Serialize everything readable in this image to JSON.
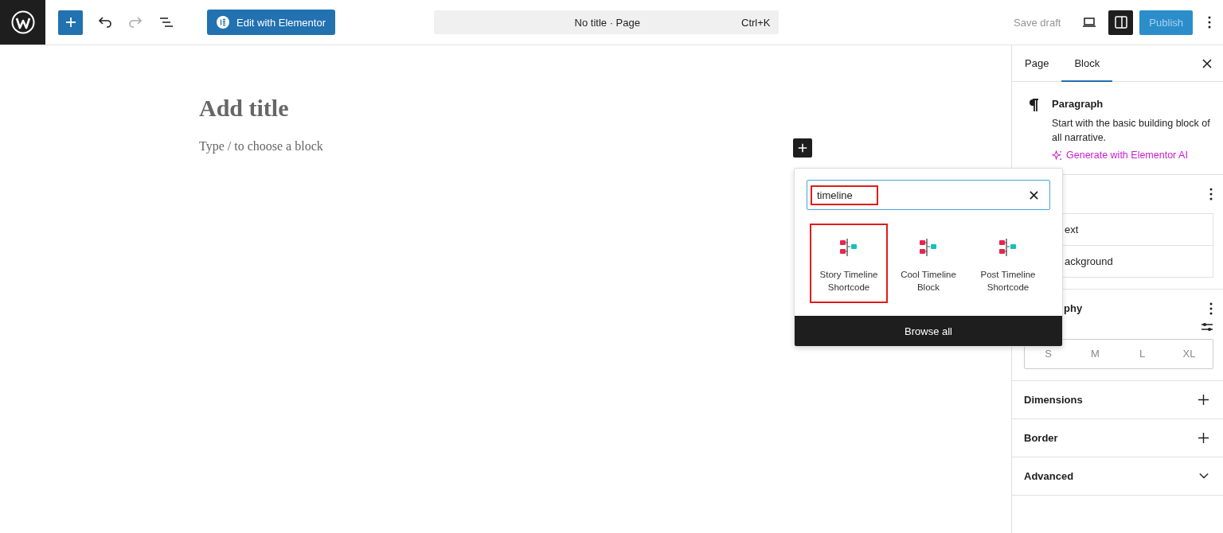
{
  "topbar": {
    "edit_button": "Edit with Elementor",
    "redo_disabled": true,
    "command_bar": {
      "title": "No title · Page",
      "shortcut": "Ctrl+K"
    },
    "save_draft": "Save draft",
    "sidebar_toggle_on": true,
    "publish": "Publish"
  },
  "editor": {
    "title_placeholder": "Add title",
    "paragraph_placeholder": "Type / to choose a block"
  },
  "inserter": {
    "search": {
      "value": "timeline",
      "highlighted": true
    },
    "results": [
      {
        "label": "Story Timeline Shortcode",
        "selected": true
      },
      {
        "label": "Cool Timeline Block",
        "selected": false
      },
      {
        "label": "Post Timeline Shortcode",
        "selected": false
      }
    ],
    "browse_all": "Browse all"
  },
  "sidebar": {
    "tabs": [
      {
        "label": "Page",
        "selected": false
      },
      {
        "label": "Block",
        "selected": true
      }
    ],
    "block": {
      "name": "Paragraph",
      "description": "Start with the basic building block of all narrative.",
      "ai_link": "Generate with Elementor AI"
    },
    "color_items": [
      "ext",
      "ackground"
    ],
    "typography": {
      "heading": "phy",
      "sizes": [
        {
          "label": "S",
          "selected": false
        },
        {
          "label": "M",
          "selected": false
        },
        {
          "label": "L",
          "selected": false
        },
        {
          "label": "XL",
          "selected": false
        }
      ]
    },
    "panels": [
      {
        "label": "Dimensions",
        "kind": "plus"
      },
      {
        "label": "Border",
        "kind": "plus"
      },
      {
        "label": "Advanced",
        "kind": "chevron"
      }
    ]
  }
}
